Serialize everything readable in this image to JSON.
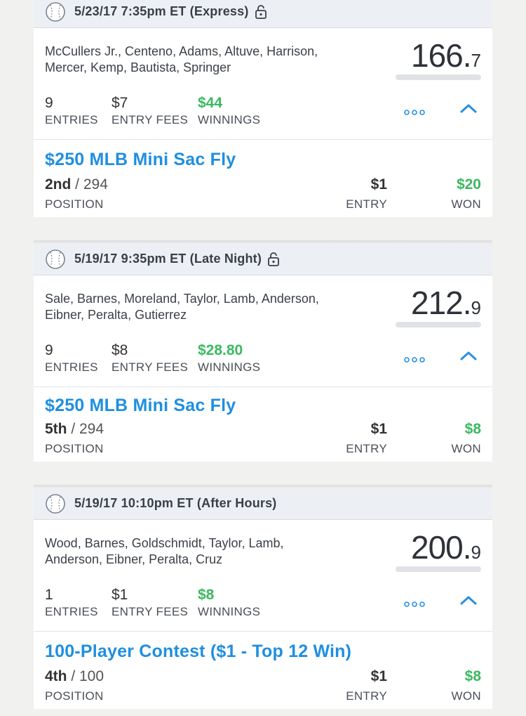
{
  "cards": [
    {
      "header": "5/23/17 7:35pm ET (Express)",
      "locked": true,
      "players_line1": "McCullers Jr., Centeno, Adams, Altuve, Harrison,",
      "players_line2": "Mercer, Kemp, Bautista, Springer",
      "score_int": "166.",
      "score_dec": "7",
      "entries": "9",
      "entries_label": "ENTRIES",
      "fees": "$7",
      "fees_label": "ENTRY FEES",
      "winnings": "$44",
      "winnings_label": "WINNINGS",
      "contest_name": "$250 MLB Mini Sac Fly",
      "position": "2nd",
      "position_total": " / 294",
      "position_label": "POSITION",
      "entry": "$1",
      "entry_label": "ENTRY",
      "won": "$20",
      "won_label": "WON"
    },
    {
      "header": "5/19/17 9:35pm ET (Late Night)",
      "locked": true,
      "players_line1": "Sale, Barnes, Moreland, Taylor, Lamb, Anderson,",
      "players_line2": "Eibner, Peralta, Gutierrez",
      "score_int": "212.",
      "score_dec": "9",
      "entries": "9",
      "entries_label": "ENTRIES",
      "fees": "$8",
      "fees_label": "ENTRY FEES",
      "winnings": "$28.80",
      "winnings_label": "WINNINGS",
      "contest_name": "$250 MLB Mini Sac Fly",
      "position": "5th",
      "position_total": " / 294",
      "position_label": "POSITION",
      "entry": "$1",
      "entry_label": "ENTRY",
      "won": "$8",
      "won_label": "WON"
    },
    {
      "header": "5/19/17 10:10pm ET (After Hours)",
      "locked": false,
      "players_line1": "Wood, Barnes, Goldschmidt, Taylor, Lamb,",
      "players_line2": "Anderson, Eibner, Peralta, Cruz",
      "score_int": "200.",
      "score_dec": "9",
      "entries": "1",
      "entries_label": "ENTRIES",
      "fees": "$1",
      "fees_label": "ENTRY FEES",
      "winnings": "$8",
      "winnings_label": "WINNINGS",
      "contest_name": "100-Player Contest ($1 - Top 12 Win)",
      "position": "4th",
      "position_total": " / 100",
      "position_label": "POSITION",
      "entry": "$1",
      "entry_label": "ENTRY",
      "won": "$8",
      "won_label": "WON"
    }
  ],
  "colors": {
    "accent_blue": "#1f8fe0",
    "win_green": "#3cb860",
    "header_bg": "#eceff4"
  },
  "icons": {
    "sport": "baseball-icon",
    "lock": "unlock-icon",
    "more": "more-dots-icon",
    "collapse": "chevron-up-icon"
  }
}
